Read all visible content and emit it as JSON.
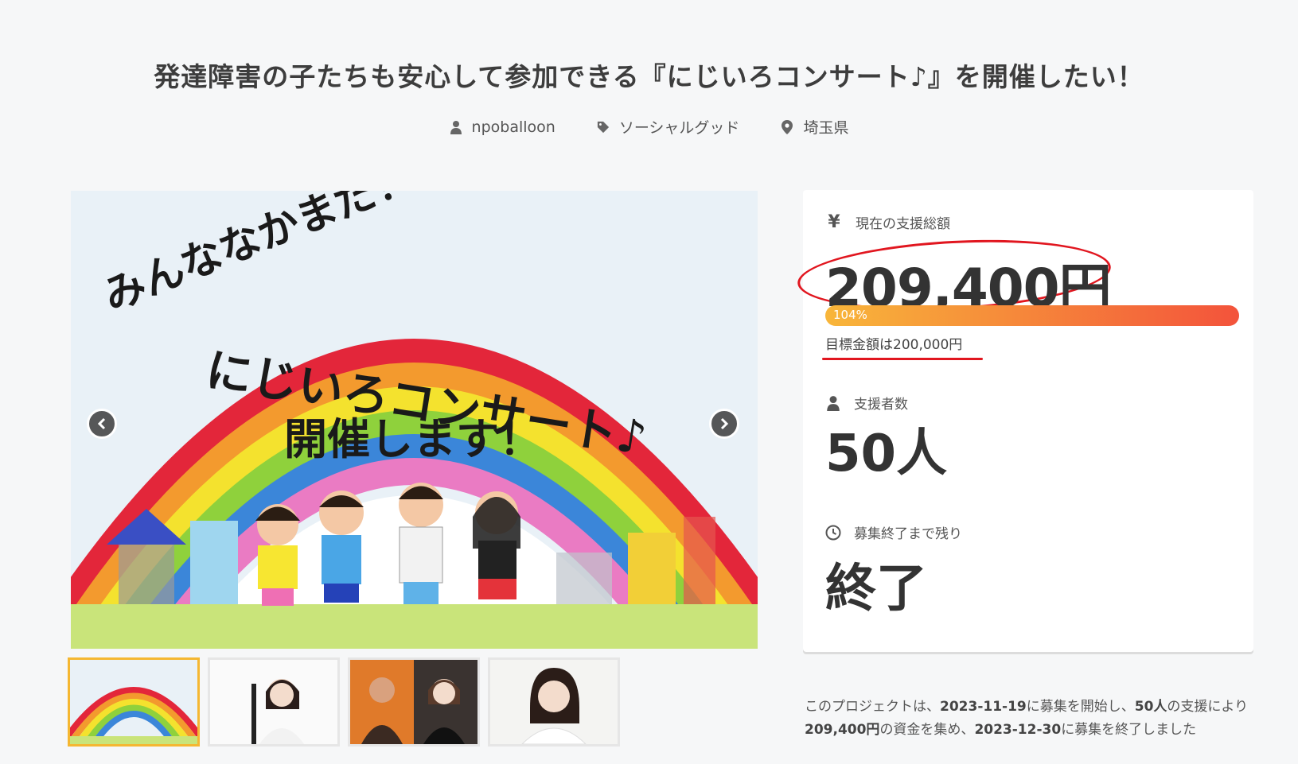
{
  "project": {
    "title": "発達障害の子たちも安心して参加できる『にじいろコンサート♪』を開催したい！",
    "author": "npoballoon",
    "category": "ソーシャルグッド",
    "location": "埼玉県"
  },
  "hero": {
    "line1": "みんななかまだ！",
    "line2": "にじいろコンサート♪",
    "line3": "開催します！"
  },
  "stats": {
    "total_label": "現在の支援総額",
    "total_amount": "209,400円",
    "progress_label": "104%",
    "progress_fraction": 1.04,
    "goal_text": "目標金額は200,000円",
    "supporters_label": "支援者数",
    "supporters_value": "50人",
    "remaining_label": "募集終了まで残り",
    "remaining_value": "終了"
  },
  "summary": {
    "t1": "このプロジェクトは、",
    "start_date": "2023-11-19",
    "t2": "に募集を開始し、",
    "supporters": "50人",
    "t3": "の支援により",
    "amount": "209,400円",
    "t4": "の資金を集め、",
    "end_date": "2023-12-30",
    "t5": "に募集を終了しました"
  },
  "colors": {
    "accent_red": "#e1161f",
    "progress_start": "#f8b63a",
    "progress_end": "#f3533b",
    "thumb_active": "#f5b731"
  },
  "icons": [
    "user-icon",
    "tag-icon",
    "map-pin-icon",
    "yen-icon",
    "clock-icon",
    "chevron-left-icon",
    "chevron-right-icon"
  ]
}
